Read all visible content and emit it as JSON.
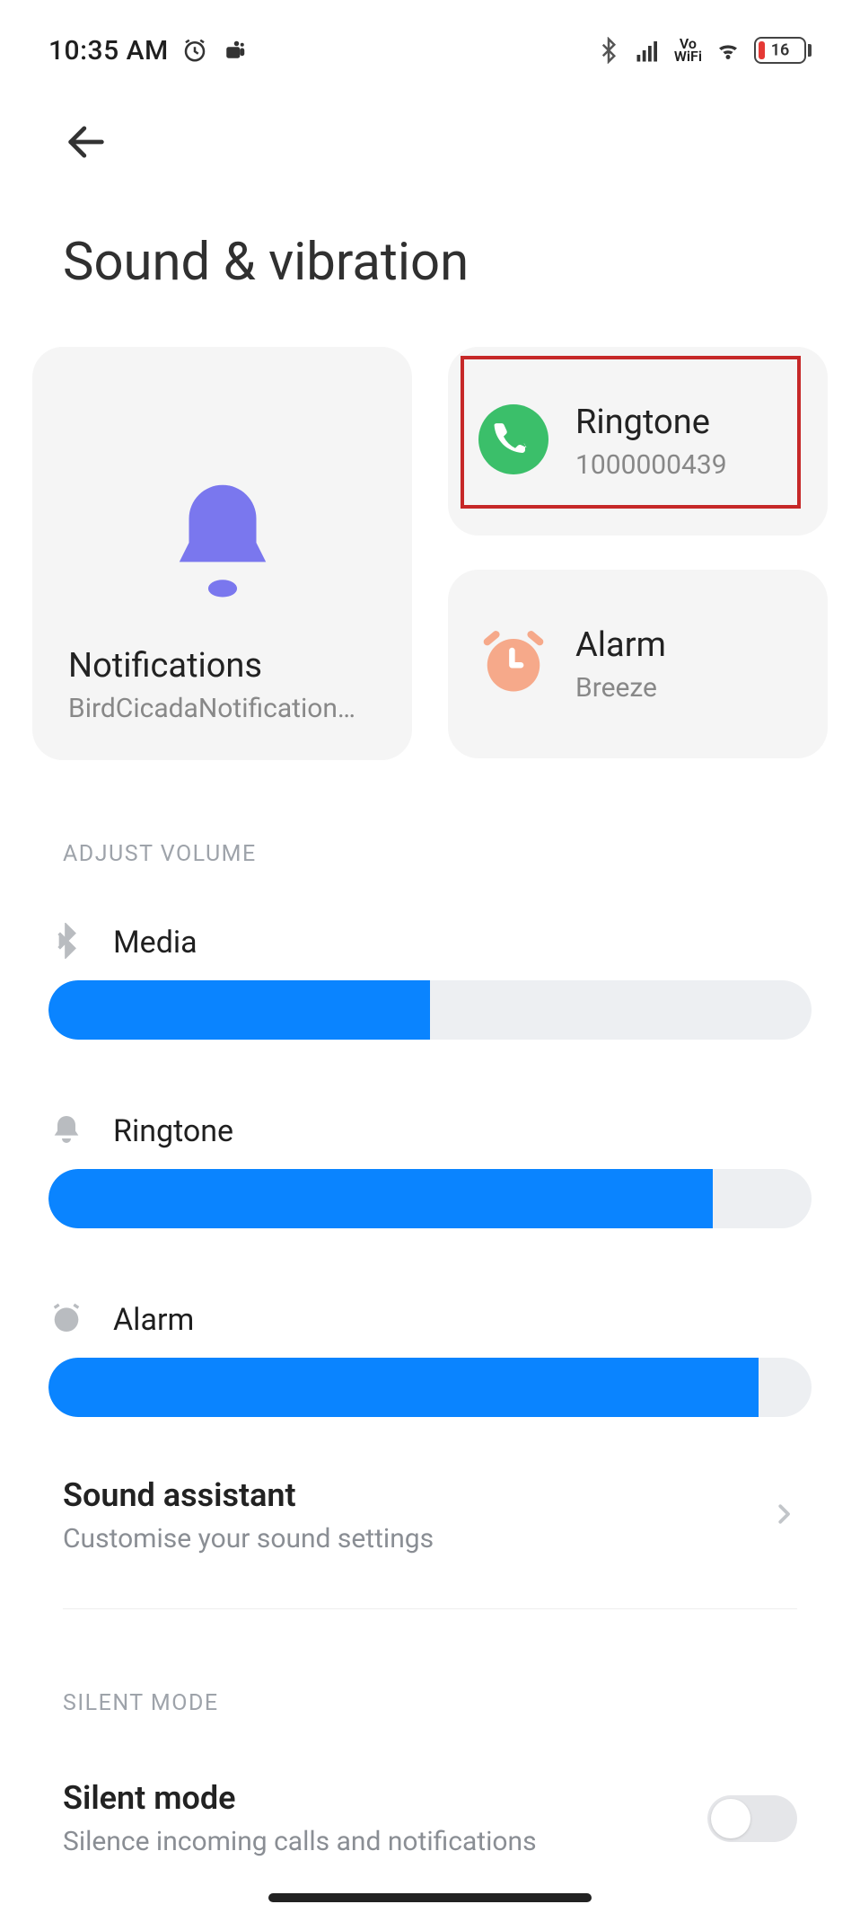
{
  "status": {
    "time": "10:35 AM",
    "battery": 16,
    "battery_fill_pct": 14
  },
  "header": {
    "title": "Sound & vibration"
  },
  "cards": {
    "notifications": {
      "title": "Notifications",
      "subtitle": "BirdCicadaNotification…"
    },
    "ringtone": {
      "title": "Ringtone",
      "subtitle": "1000000439"
    },
    "alarm": {
      "title": "Alarm",
      "subtitle": "Breeze"
    }
  },
  "sections": {
    "adjust_volume": "Adjust volume",
    "silent_mode": "Silent mode"
  },
  "volumes": {
    "media": {
      "label": "Media",
      "percent": 50
    },
    "ringtone": {
      "label": "Ringtone",
      "percent": 87
    },
    "alarm": {
      "label": "Alarm",
      "percent": 93
    }
  },
  "rows": {
    "sound_assistant": {
      "title": "Sound assistant",
      "sub": "Customise your sound settings"
    },
    "silent_mode": {
      "title": "Silent mode",
      "sub": "Silence incoming calls and notifications",
      "enabled": false
    }
  },
  "colors": {
    "slider_fill": "#0a84ff",
    "notif_icon": "#7a77ee",
    "phone_icon": "#3bbf6a",
    "alarm_icon": "#f6a98a",
    "highlight": "#c62828"
  }
}
